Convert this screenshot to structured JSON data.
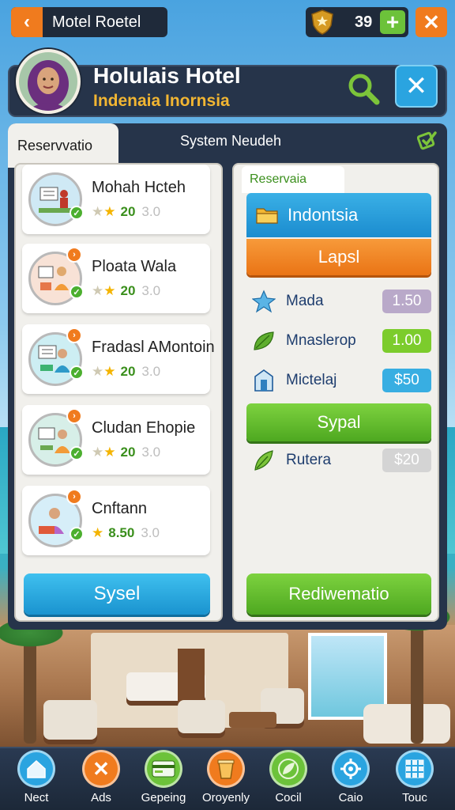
{
  "topbar": {
    "back_label": "Motel Roetel",
    "coins": "39"
  },
  "header": {
    "title": "Holulais Hotel",
    "subtitle": "Indenaia Inornsia"
  },
  "tabs": {
    "active": "Reservvatio",
    "system": "System Neudeh"
  },
  "hotels": [
    {
      "name": "Mohah Hcteh",
      "score": "20",
      "max": "3.0",
      "icon": "reception-icon"
    },
    {
      "name": "Ploata Wala",
      "score": "20",
      "max": "3.0",
      "icon": "guest-service-icon"
    },
    {
      "name": "Fradasl AMontoin",
      "score": "20",
      "max": "3.0",
      "icon": "front-desk-icon"
    },
    {
      "name": "Cludan Ehopie",
      "score": "20",
      "max": "3.0",
      "icon": "concierge-icon"
    },
    {
      "name": "Cnftann",
      "score": "8.50",
      "max": "3.0",
      "icon": "staff-icon"
    }
  ],
  "left_button": "Sysel",
  "right": {
    "tab": "Reservaia",
    "country": "Indontsia",
    "lapsl": "Lapsl",
    "stats": [
      {
        "label": "Mada",
        "value": "1.50",
        "color": "#b9a9c9",
        "icon": "star-icon"
      },
      {
        "label": "Mnaslerop",
        "value": "1.00",
        "color": "#7ccc2c",
        "icon": "leaf-icon"
      },
      {
        "label": "Mictelaj",
        "value": "$50",
        "color": "#38aee2",
        "icon": "building-icon"
      }
    ],
    "sypal": "Sypal",
    "extra": {
      "label": "Rutera",
      "value": "$20",
      "color": "#d4d4d4",
      "icon": "feather-icon"
    },
    "redirect": "Rediwematio"
  },
  "nav": [
    {
      "label": "Nect",
      "icon": "home-icon",
      "color": "#2aa4e0"
    },
    {
      "label": "Ads",
      "icon": "close-icon",
      "color": "#f07b1e"
    },
    {
      "label": "Gepeing",
      "icon": "card-icon",
      "color": "#6cc23a"
    },
    {
      "label": "Oroyenly",
      "icon": "bucket-icon",
      "color": "#f07b1e"
    },
    {
      "label": "Cocil",
      "icon": "leaf-icon",
      "color": "#6cc23a"
    },
    {
      "label": "Caio",
      "icon": "gear-icon",
      "color": "#2aa4e0"
    },
    {
      "label": "Touc",
      "icon": "grid-icon",
      "color": "#2aa4e0"
    }
  ]
}
